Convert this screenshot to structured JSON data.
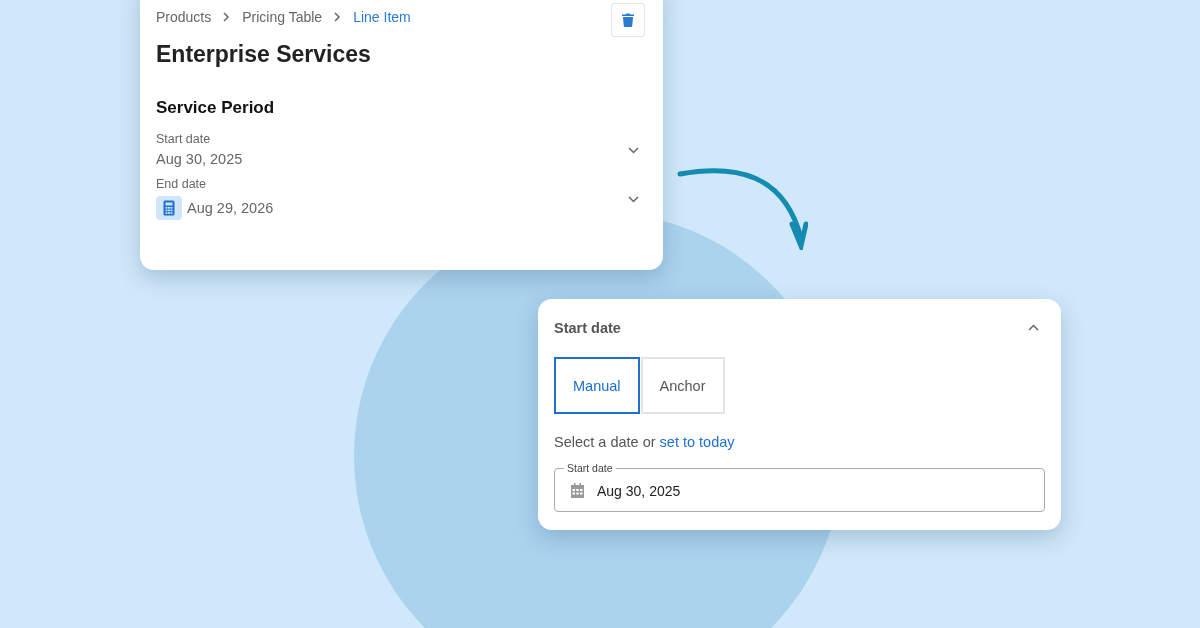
{
  "breadcrumbs": [
    {
      "label": "Products",
      "selected": false
    },
    {
      "label": "Pricing Table",
      "selected": false
    },
    {
      "label": "Line Item",
      "selected": true
    }
  ],
  "title": "Enterprise Services",
  "section": "Service Period",
  "fields": [
    {
      "label": "Start date",
      "value": "Aug 30, 2025",
      "kind": "plain",
      "expanded": false
    },
    {
      "label": "End date",
      "value": "Aug 29, 2026",
      "kind": "calculated",
      "expanded": false
    }
  ],
  "popover": {
    "title": "Start date",
    "expanded": true,
    "modes": [
      {
        "label": "Manual",
        "selected": true
      },
      {
        "label": "Anchor",
        "selected": false
      }
    ],
    "hint": "Select a date or",
    "link": "set to today",
    "input": {
      "label": "Start date",
      "value": "Aug 30, 2025"
    }
  }
}
